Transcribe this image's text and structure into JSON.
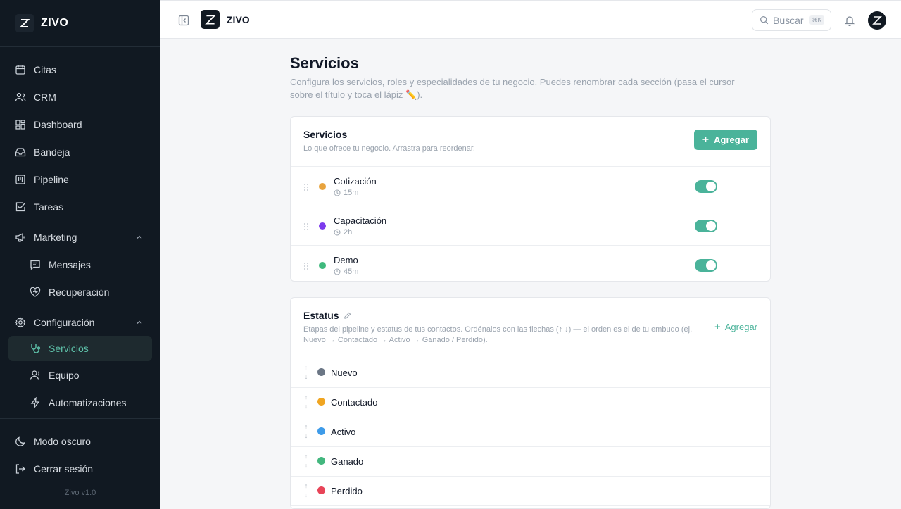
{
  "app": {
    "brand": "ZIVO",
    "version": "Zivo v1.0"
  },
  "sidebar": {
    "items": [
      {
        "label": "Citas",
        "icon": "calendar-icon"
      },
      {
        "label": "CRM",
        "icon": "users-icon"
      },
      {
        "label": "Dashboard",
        "icon": "dashboard-icon"
      },
      {
        "label": "Bandeja",
        "icon": "inbox-icon"
      },
      {
        "label": "Pipeline",
        "icon": "pipeline-icon"
      },
      {
        "label": "Tareas",
        "icon": "check-square-icon"
      },
      {
        "label": "Marketing",
        "icon": "megaphone-icon",
        "expanded": true
      },
      {
        "label": "Mensajes",
        "icon": "message-icon"
      },
      {
        "label": "Recuperación",
        "icon": "heart-icon"
      },
      {
        "label": "Configuración",
        "icon": "gear-icon",
        "expanded": true
      },
      {
        "label": "Servicios",
        "icon": "stethoscope-icon",
        "active": true
      },
      {
        "label": "Equipo",
        "icon": "user-icon"
      },
      {
        "label": "Automatizaciones",
        "icon": "bolt-icon"
      }
    ],
    "bottom": [
      {
        "label": "Modo oscuro",
        "icon": "moon-icon"
      },
      {
        "label": "Cerrar sesión",
        "icon": "logout-icon"
      }
    ]
  },
  "header": {
    "title": "ZIVO",
    "search_placeholder": "Buscar",
    "search_shortcut": "⌘K"
  },
  "page": {
    "title": "Servicios",
    "description": "Configura los servicios, roles y especialidades de tu negocio. Puedes renombrar cada sección (pasa el cursor sobre el título y toca el lápiz ✏️)."
  },
  "services": {
    "title": "Servicios",
    "subtitle": "Lo que ofrece tu negocio. Arrastra para reordenar.",
    "add_label": "Agregar",
    "rows": [
      {
        "name": "Cotización",
        "duration": "15m",
        "color": "#e8a33d",
        "enabled": true
      },
      {
        "name": "Capacitación",
        "duration": "2h",
        "color": "#7c3aed",
        "enabled": true
      },
      {
        "name": "Demo",
        "duration": "45m",
        "color": "#3fb97d",
        "enabled": true
      }
    ]
  },
  "status": {
    "title": "Estatus",
    "subtitle": "Etapas del pipeline y estatus de tus contactos. Ordénalos con las flechas (↑ ↓) — el orden es el de tu embudo (ej. Nuevo → Contactado → Activo → Ganado / Perdido).",
    "add_label": "Agregar",
    "rows": [
      {
        "name": "Nuevo",
        "color": "#6b7685"
      },
      {
        "name": "Contactado",
        "color": "#f0a521"
      },
      {
        "name": "Activo",
        "color": "#3e9be9"
      },
      {
        "name": "Ganado",
        "color": "#43b77e"
      },
      {
        "name": "Perdido",
        "color": "#e84458"
      }
    ]
  },
  "colors": {
    "accent": "#4ab39a",
    "sidebar_bg": "#111922"
  }
}
